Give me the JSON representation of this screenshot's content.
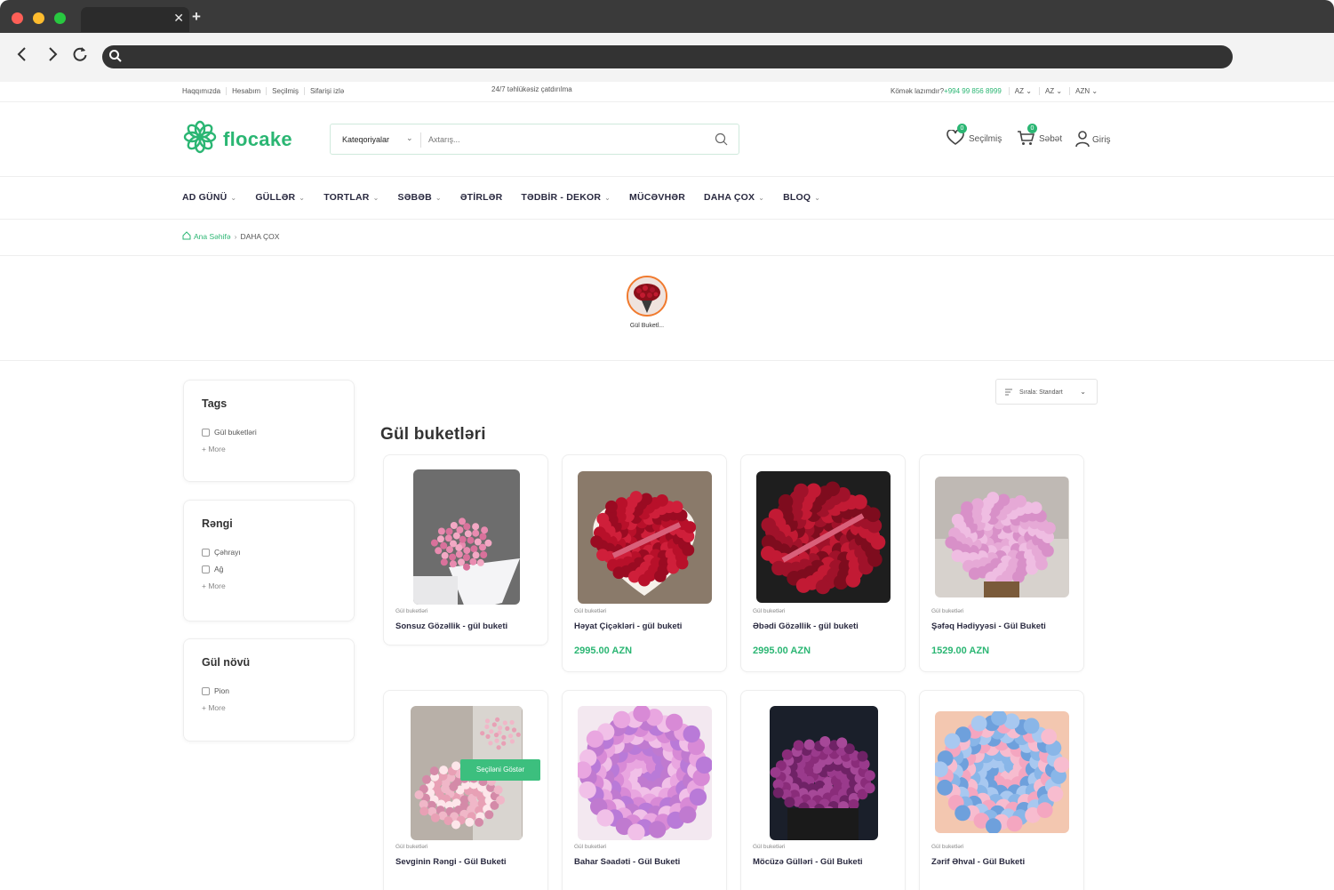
{
  "infobar": {
    "links": [
      "Haqqımızda",
      "Hesabım",
      "Seçilmiş",
      "Sifarişi izlə"
    ],
    "center": "24/7 təhlükəsiz çatdırılma",
    "help_label": "Kömək lazımdır?",
    "phone": "+994 99 856 8999",
    "lang1": "AZ",
    "lang2": "AZ",
    "currency": "AZN"
  },
  "header": {
    "logo": "flocake",
    "category_select": "Kateqoriyalar",
    "search_placeholder": "Axtarış...",
    "wishlist_label": "Seçilmiş",
    "wishlist_count": "0",
    "cart_label": "Səbət",
    "cart_count": "0",
    "login_label": "Giriş"
  },
  "nav": [
    {
      "label": "AD GÜNÜ",
      "chev": true
    },
    {
      "label": "GÜLLƏR",
      "chev": true
    },
    {
      "label": "TORTLAR",
      "chev": true
    },
    {
      "label": "SƏBƏB",
      "chev": true
    },
    {
      "label": "ƏTİRLƏR",
      "chev": false
    },
    {
      "label": "TƏDBİR - DEKOR",
      "chev": true
    },
    {
      "label": "MÜCƏVHƏR",
      "chev": false
    },
    {
      "label": "DAHA ÇOX",
      "chev": true
    },
    {
      "label": "BLOQ",
      "chev": true
    }
  ],
  "breadcrumb": {
    "home": "Ana Səhifə",
    "current": "DAHA ÇOX"
  },
  "category": {
    "label": "Gül Buketl..."
  },
  "filters": [
    {
      "title": "Tags",
      "options": [
        "Gül buketləri"
      ],
      "more": "+ More"
    },
    {
      "title": "Rəngi",
      "options": [
        "Çəhrayı",
        "Ağ"
      ],
      "more": "+ More"
    },
    {
      "title": "Gül növü",
      "options": [
        "Pion"
      ],
      "more": "+ More"
    }
  ],
  "sort": {
    "label": "Sırala: Standart"
  },
  "listing": {
    "title": "Gül buketləri",
    "quickview": "Seçiləni Göstər"
  },
  "products": [
    {
      "cat": "Gül buketləri",
      "name": "Sonsuz Gözəllik - gül buketi",
      "price": ""
    },
    {
      "cat": "Gül buketləri",
      "name": "Həyat Çiçəkləri - gül buketi",
      "price": "2995.00 AZN"
    },
    {
      "cat": "Gül buketləri",
      "name": "Əbədi Gözəllik - gül buketi",
      "price": "2995.00 AZN"
    },
    {
      "cat": "Gül buketləri",
      "name": "Şəfəq Hədiyyəsi - Gül Buketi",
      "price": "1529.00 AZN"
    },
    {
      "cat": "Gül buketləri",
      "name": "Sevginin Rəngi - Gül Buketi",
      "price": ""
    },
    {
      "cat": "Gül buketləri",
      "name": "Bahar Səadəti - Gül Buketi",
      "price": ""
    },
    {
      "cat": "Gül buketləri",
      "name": "Möcüzə Gülləri - Gül Buketi",
      "price": ""
    },
    {
      "cat": "Gül buketləri",
      "name": "Zərif Əhval - Gül Buketi",
      "price": ""
    }
  ],
  "colors": {
    "brand": "#2bb673",
    "text": "#2a2a40"
  }
}
